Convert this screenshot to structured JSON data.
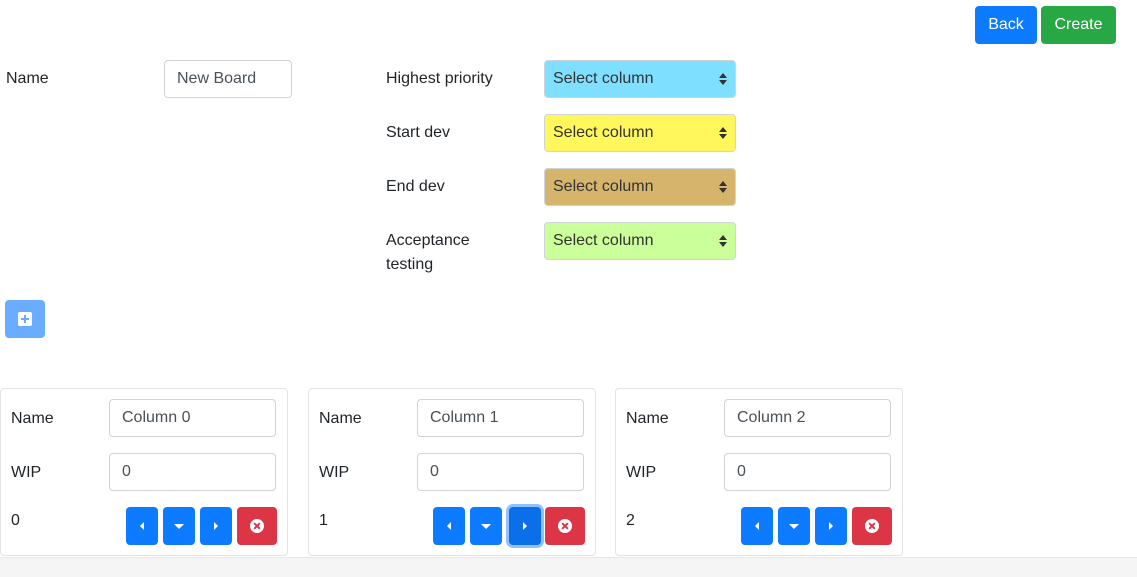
{
  "toolbar": {
    "back_label": "Back",
    "create_label": "Create",
    "back_color": "#0d7bff",
    "create_color": "#28a745"
  },
  "board": {
    "name_label": "Name",
    "name_value": "New Board"
  },
  "priority_fields": [
    {
      "label_line1": "Highest priority",
      "label_line2": "",
      "selected": "Select column",
      "color": "#7fdfff"
    },
    {
      "label_line1": "Start dev",
      "label_line2": "",
      "selected": "Select column",
      "color": "#fff75c"
    },
    {
      "label_line1": "End dev",
      "label_line2": "",
      "selected": "Select column",
      "color": "#d6b46c"
    },
    {
      "label_line1": "Acceptance",
      "label_line2": "testing",
      "selected": "Select column",
      "color": "#cbff9a"
    }
  ],
  "add_column": {
    "icon": "plus-square-icon"
  },
  "columns": [
    {
      "name_label": "Name",
      "name_value": "Column 0",
      "wip_label": "WIP",
      "wip_value": "0",
      "index": "0"
    },
    {
      "name_label": "Name",
      "name_value": "Column 1",
      "wip_label": "WIP",
      "wip_value": "0",
      "index": "1"
    },
    {
      "name_label": "Name",
      "name_value": "Column 2",
      "wip_label": "WIP",
      "wip_value": "0",
      "index": "2"
    }
  ]
}
